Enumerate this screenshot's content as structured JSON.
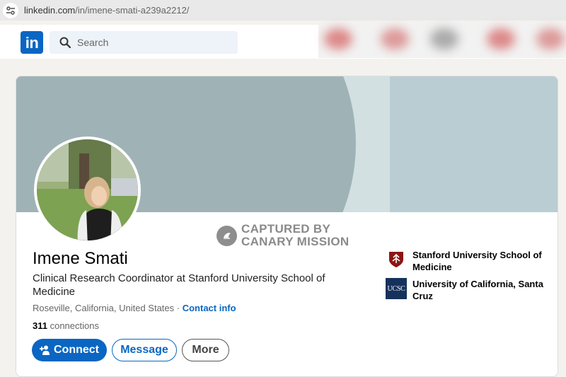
{
  "browser": {
    "url_host": "linkedin.com",
    "url_path": "/in/imene-smati-a239a2212/"
  },
  "header": {
    "logo_text": "in",
    "search_placeholder": "Search"
  },
  "watermark": {
    "line1": "CAPTURED BY",
    "line2": "CANARY MISSION"
  },
  "profile": {
    "name": "Imene Smati",
    "headline": "Clinical Research Coordinator at Stanford University School of Medicine",
    "location": "Roseville, California, United States",
    "separator": " · ",
    "contact_label": "Contact info",
    "connections_count": "311",
    "connections_label": " connections"
  },
  "actions": {
    "connect_label": "Connect",
    "message_label": "Message",
    "more_label": "More"
  },
  "education": [
    {
      "name": "Stanford University School of Medicine",
      "logo": "stanford-shield-icon"
    },
    {
      "name": "University of California, Santa Cruz",
      "logo": "ucsc-logo-icon",
      "logo_text": "UCSC"
    }
  ],
  "colors": {
    "linkedin_blue": "#0a66c2",
    "banner_dark": "#9fb3b6",
    "banner_light": "#bacdd3",
    "stanford_red": "#8c1515",
    "ucsc_navy": "#16325c"
  }
}
